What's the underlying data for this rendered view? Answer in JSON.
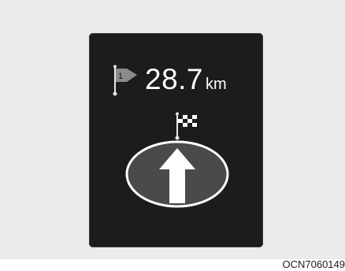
{
  "navigation": {
    "distance_value": "28.7",
    "distance_unit": "km",
    "waypoint_number": "1",
    "maneuver_icon": "straight-arrow-icon",
    "waypoint_icon": "waypoint-flag-icon",
    "destination_icon": "checkered-flag-icon"
  },
  "caption": {
    "image_code": "OCN7060149"
  },
  "colors": {
    "background": "#ebebeb",
    "display": "#1c1c1c",
    "foreground": "#ffffff"
  }
}
